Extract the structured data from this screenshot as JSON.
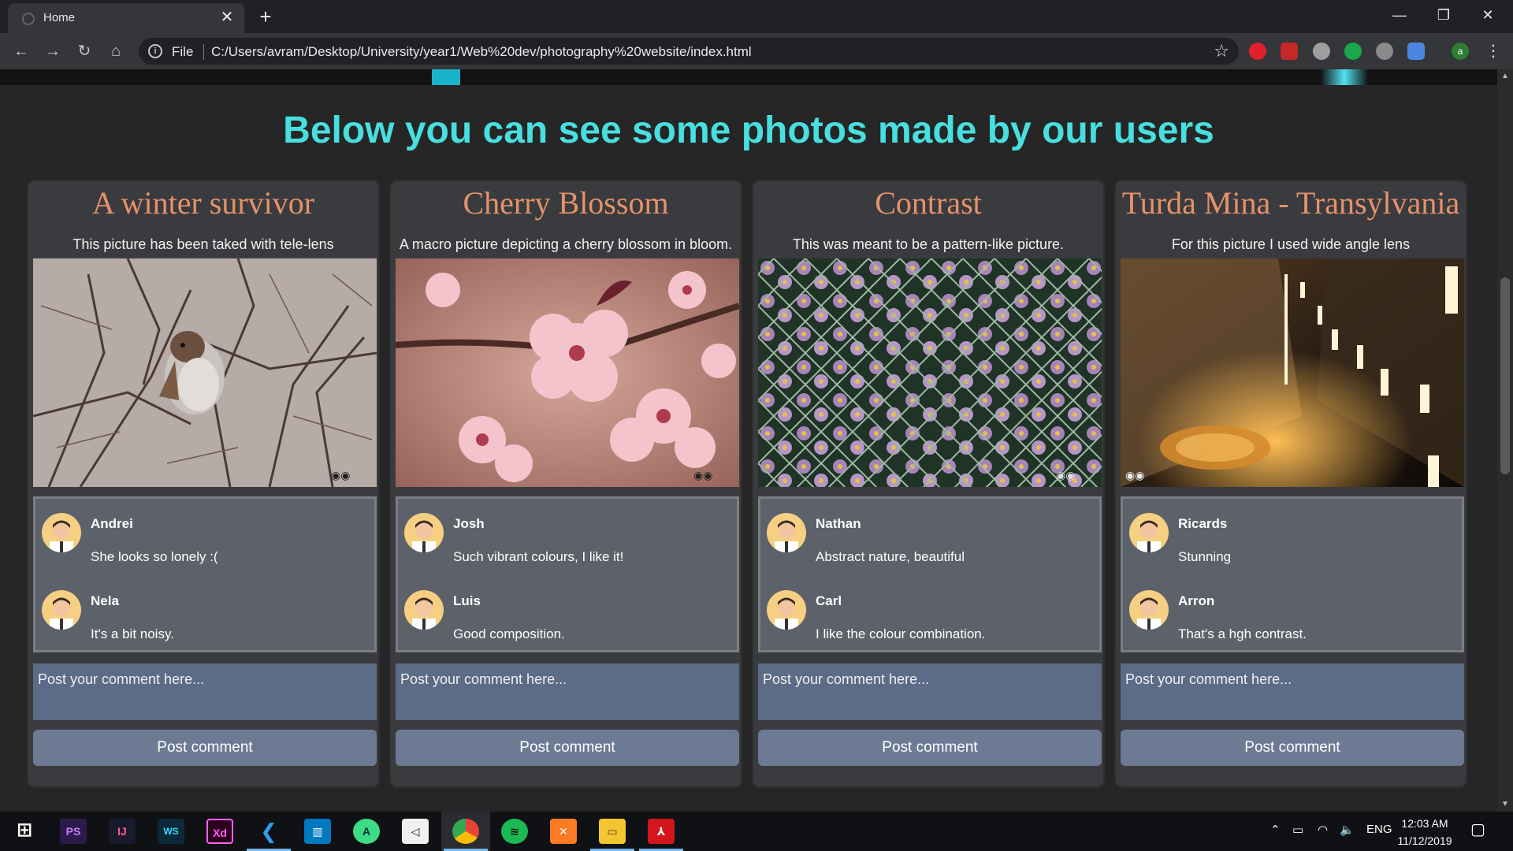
{
  "browser": {
    "tab_title": "Home",
    "omnibox_scheme_label": "File",
    "url": "C:/Users/avram/Desktop/University/year1/Web%20dev/photography%20website/index.html",
    "extension_avatar_letter": "a"
  },
  "page": {
    "heading": "Below you can see some photos made by our users",
    "cards": [
      {
        "title": "A winter survivor",
        "description": "This picture has been taked with tele-lens",
        "comments": [
          {
            "name": "Andrei",
            "text": "She looks so lonely :("
          },
          {
            "name": "Nela",
            "text": "It's a bit noisy."
          }
        ],
        "input_placeholder": "Post your comment here...",
        "button_label": "Post comment"
      },
      {
        "title": "Cherry Blossom",
        "description": "A macro picture depicting a cherry blossom in bloom.",
        "comments": [
          {
            "name": "Josh",
            "text": "Such vibrant colours, I like it!"
          },
          {
            "name": "Luis",
            "text": "Good composition."
          }
        ],
        "input_placeholder": "Post your comment here...",
        "button_label": "Post comment"
      },
      {
        "title": "Contrast",
        "description": "This was meant to be a pattern-like picture.",
        "comments": [
          {
            "name": "Nathan",
            "text": "Abstract nature, beautiful"
          },
          {
            "name": "Carl",
            "text": "I like the colour combination."
          }
        ],
        "input_placeholder": "Post your comment here...",
        "button_label": "Post comment"
      },
      {
        "title": "Turda Mina - Transylvania",
        "description": "For this picture I used wide angle lens",
        "comments": [
          {
            "name": "Ricards",
            "text": "Stunning"
          },
          {
            "name": "Arron",
            "text": "That's a hgh contrast."
          }
        ],
        "input_placeholder": "Post your comment here...",
        "button_label": "Post comment"
      }
    ]
  },
  "taskbar": {
    "apps": [
      "PS",
      "IJ",
      "WS",
      "Xd",
      "VS Code",
      "Trello",
      "Android Studio",
      "Unity",
      "Chrome",
      "Spotify",
      "XAMPP",
      "Explorer",
      "Acrobat"
    ],
    "language": "ENG",
    "time": "12:03 AM",
    "date": "11/12/2019"
  },
  "colors": {
    "heading": "#47dfe0",
    "card_title": "#e6926b",
    "card_bg": "#3a3b3e",
    "comment_box": "#5d6169",
    "input_bg": "#5c6b86",
    "button_bg": "#6c7a93"
  }
}
